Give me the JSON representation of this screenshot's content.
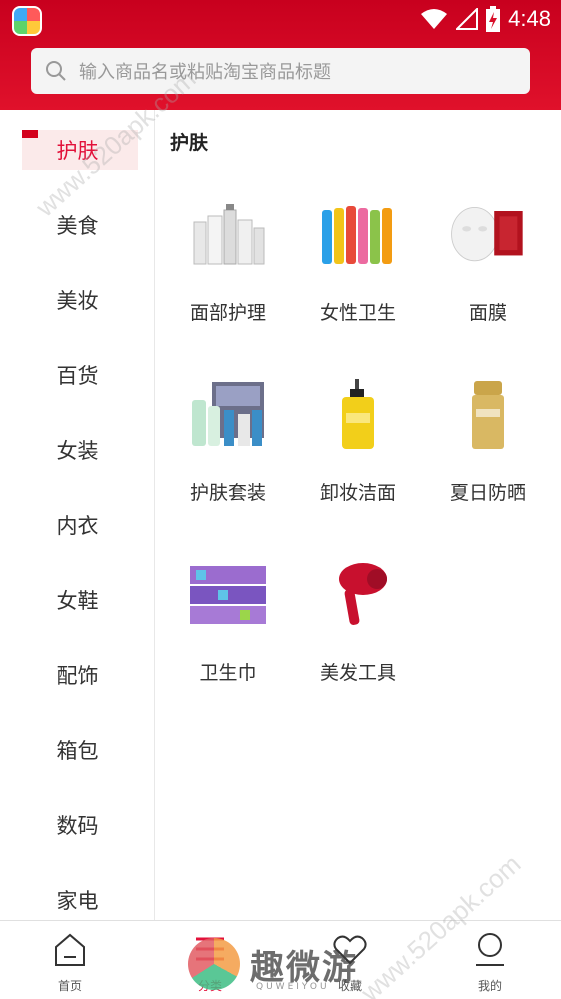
{
  "status_bar": {
    "time": "4:48"
  },
  "search": {
    "placeholder": "输入商品名或粘贴淘宝商品标题"
  },
  "sidebar": {
    "active_index": 0,
    "items": [
      "护肤",
      "美食",
      "美妆",
      "百货",
      "女装",
      "内衣",
      "女鞋",
      "配饰",
      "箱包",
      "数码",
      "家电"
    ]
  },
  "content": {
    "section_title": "护肤",
    "items": [
      {
        "label": "面部护理",
        "icon": "skincare-bottles-icon"
      },
      {
        "label": "女性卫生",
        "icon": "colorful-bottles-icon"
      },
      {
        "label": "面膜",
        "icon": "face-mask-icon"
      },
      {
        "label": "护肤套装",
        "icon": "skincare-set-icon"
      },
      {
        "label": "卸妆洁面",
        "icon": "cleansing-oil-icon"
      },
      {
        "label": "夏日防晒",
        "icon": "sunscreen-icon"
      },
      {
        "label": "卫生巾",
        "icon": "sanitary-pads-icon"
      },
      {
        "label": "美发工具",
        "icon": "hair-dryer-icon"
      }
    ]
  },
  "bottom_nav": {
    "active_index": 1,
    "items": [
      {
        "label": "首页",
        "icon": "home-icon"
      },
      {
        "label": "分类",
        "icon": "category-icon"
      },
      {
        "label": "收藏",
        "icon": "heart-icon"
      },
      {
        "label": "我的",
        "icon": "user-icon"
      }
    ]
  },
  "watermarks": {
    "site": "www.520apk.com",
    "logo_text": "趣微游",
    "logo_sub": "QUWEIYOU"
  },
  "colors": {
    "header": "#d8102a",
    "accent": "#e2113a"
  }
}
